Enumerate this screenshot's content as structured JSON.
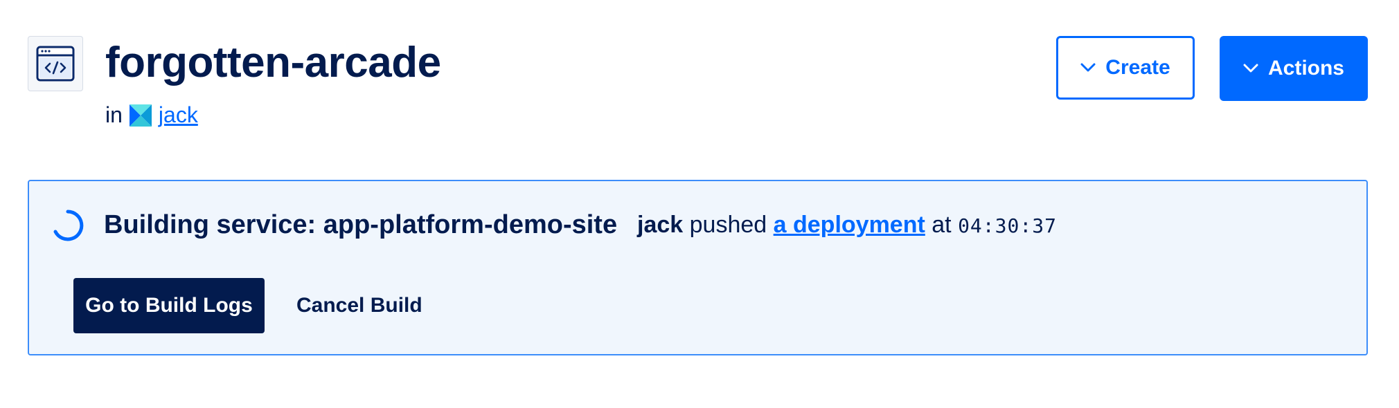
{
  "app": {
    "title": "forgotten-arcade",
    "team_prefix": "in",
    "team_name": "jack"
  },
  "header_actions": {
    "create_label": "Create",
    "actions_label": "Actions"
  },
  "build_banner": {
    "status_text": "Building service: app-platform-demo-site",
    "pusher": "jack",
    "pushed_text": "pushed",
    "deployment_link": "a deployment",
    "at_text": "at",
    "time": "04:30:37",
    "build_logs_button": "Go to Build Logs",
    "cancel_button": "Cancel Build"
  },
  "colors": {
    "primary": "#0069ff",
    "navy": "#031b4e",
    "banner_bg": "#f0f6fd",
    "banner_border": "#3c8dfa"
  },
  "icons": {
    "app": "code-window-icon",
    "team": "team-logo-icon",
    "chevron": "chevron-down-icon",
    "spinner": "loading-spinner-icon"
  }
}
